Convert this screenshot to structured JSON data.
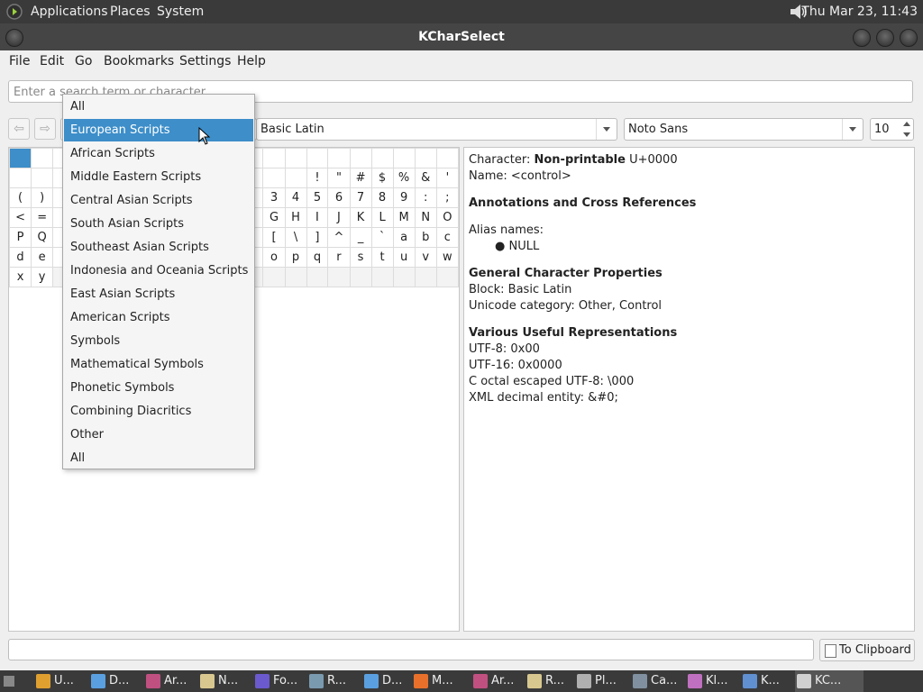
{
  "top_panel": {
    "menus": [
      "Applications",
      "Places",
      "System"
    ],
    "clock": "Thu Mar 23, 11:43",
    "icons": [
      "gnome-foot-icon",
      "speaker-icon"
    ]
  },
  "window": {
    "title": "KCharSelect"
  },
  "menubar": {
    "items": [
      {
        "label": "File",
        "mnemonic": "F"
      },
      {
        "label": "Edit",
        "mnemonic": "E"
      },
      {
        "label": "Go",
        "mnemonic": "G"
      },
      {
        "label": "Bookmarks",
        "mnemonic": "B"
      },
      {
        "label": "Settings",
        "mnemonic": "S"
      },
      {
        "label": "Help",
        "mnemonic": "H"
      }
    ]
  },
  "search": {
    "placeholder": "Enter a search term or character...",
    "value": ""
  },
  "toolbar": {
    "back_icon": "arrow-left-icon",
    "forward_icon": "arrow-right-icon",
    "block_value": "Basic Latin",
    "font_value": "Noto Sans",
    "size_value": "10"
  },
  "category_dropdown": {
    "selected_index": 1,
    "options": [
      "All",
      "European Scripts",
      "African Scripts",
      "Middle Eastern Scripts",
      "Central Asian Scripts",
      "South Asian Scripts",
      "Southeast Asian Scripts",
      "Indonesia and Oceania Scripts",
      "East Asian Scripts",
      "American Scripts",
      "Symbols",
      "Mathematical Symbols",
      "Phonetic Symbols",
      "Combining Diacritics",
      "Other",
      "All"
    ]
  },
  "grid": {
    "rows": [
      [
        "",
        "",
        "",
        "",
        "",
        "",
        "",
        "",
        "",
        "",
        "",
        "",
        "",
        "",
        "",
        "",
        "",
        "",
        "",
        "",
        ""
      ],
      [
        "",
        "",
        "",
        "",
        "",
        "",
        "",
        "",
        "",
        "",
        "",
        "",
        "",
        "",
        "!",
        "\"",
        "#",
        "$",
        "%",
        "&",
        "'"
      ],
      [
        "(",
        ")",
        "",
        "",
        "",
        "",
        "",
        "",
        "",
        "",
        "",
        "",
        "3",
        "4",
        "5",
        "6",
        "7",
        "8",
        "9",
        ":",
        ";"
      ],
      [
        "<",
        "=",
        "",
        "",
        "",
        "",
        "",
        "",
        "",
        "",
        "",
        "",
        "G",
        "H",
        "I",
        "J",
        "K",
        "L",
        "M",
        "N",
        "O"
      ],
      [
        "P",
        "Q",
        "",
        "",
        "",
        "",
        "",
        "",
        "",
        "",
        "",
        "",
        "[",
        "\\",
        "]",
        "^",
        "_",
        "`",
        "a",
        "b",
        "c"
      ],
      [
        "d",
        "e",
        "",
        "",
        "",
        "",
        "",
        "",
        "",
        "",
        "",
        "",
        "o",
        "p",
        "q",
        "r",
        "s",
        "t",
        "u",
        "v",
        "w"
      ],
      [
        "x",
        "y",
        "",
        "",
        "",
        "",
        "",
        "",
        "",
        "",
        "",
        "",
        "",
        "",
        "",
        "",
        "",
        "",
        "",
        "",
        ""
      ]
    ]
  },
  "info": {
    "character_label": "Character:",
    "character_value": "Non-printable",
    "character_code": "U+0000",
    "name_line": "Name: <control>",
    "annotations_heading": "Annotations and Cross References",
    "alias_label": "Alias names:",
    "alias_items": [
      "NULL"
    ],
    "general_heading": "General Character Properties",
    "block_line": "Block: Basic Latin",
    "category_line": "Unicode category: Other, Control",
    "representations_heading": "Various Useful Representations",
    "utf8_line": "UTF-8: 0x00",
    "utf16_line": "UTF-16: 0x0000",
    "octal_line": "C octal escaped UTF-8: \\000",
    "xml_line": "XML decimal entity: &#0;"
  },
  "bottom": {
    "text_value": "",
    "clipboard_label": "To Clipboard",
    "clipboard_mnemonic": "T"
  },
  "taskbar": {
    "items": [
      {
        "label": "U...",
        "icon": "chrome-icon"
      },
      {
        "label": "D...",
        "icon": "document-icon"
      },
      {
        "label": "Ar...",
        "icon": "archive-icon"
      },
      {
        "label": "N...",
        "icon": "folder-icon"
      },
      {
        "label": "Fo...",
        "icon": "font-viewer-icon"
      },
      {
        "label": "R...",
        "icon": "screenshot-icon"
      },
      {
        "label": "D...",
        "icon": "document-icon"
      },
      {
        "label": "M...",
        "icon": "firefox-icon"
      },
      {
        "label": "Ar...",
        "icon": "archive-icon"
      },
      {
        "label": "R...",
        "icon": "folder-icon"
      },
      {
        "label": "Pl...",
        "icon": "plugin-icon"
      },
      {
        "label": "Ca...",
        "icon": "camera-icon"
      },
      {
        "label": "Kl...",
        "icon": "klipper-icon"
      },
      {
        "label": "K...",
        "icon": "window-icon"
      },
      {
        "label": "KC...",
        "icon": "kcharselect-icon"
      }
    ]
  }
}
